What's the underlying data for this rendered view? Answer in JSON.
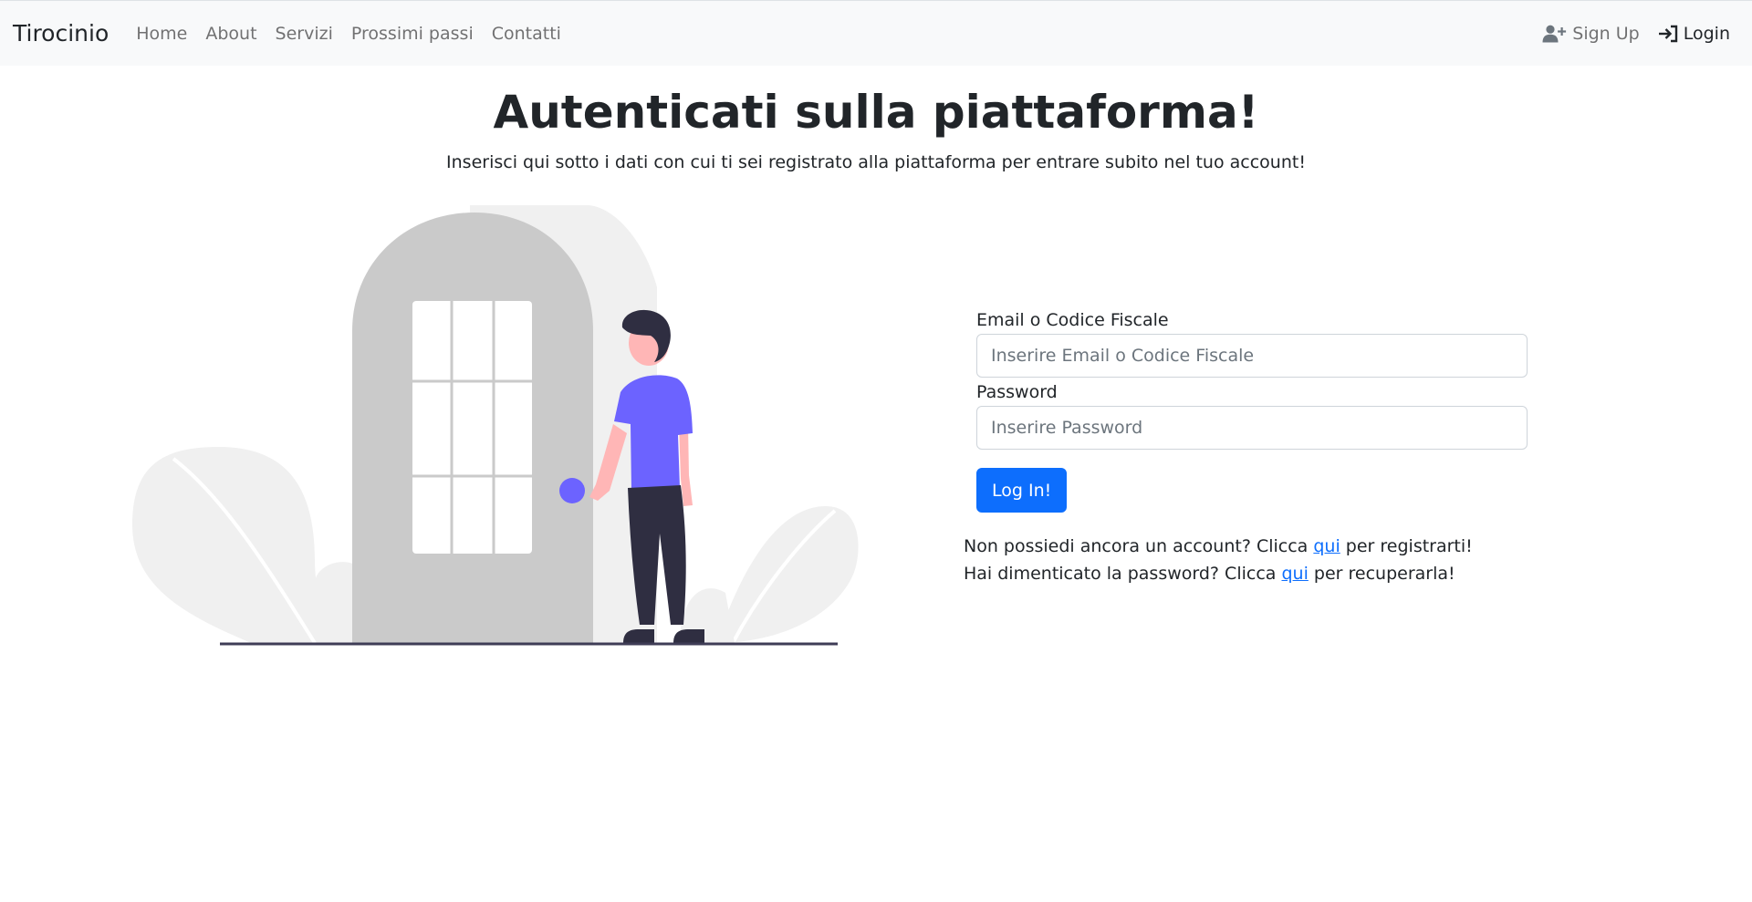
{
  "navbar": {
    "brand": "Tirocinio",
    "links": [
      "Home",
      "About",
      "Servizi",
      "Prossimi passi",
      "Contatti"
    ],
    "signup_label": "Sign Up",
    "login_label": "Login",
    "signup_icon": "user-plus-icon",
    "login_icon": "sign-in-icon"
  },
  "page": {
    "title": "Autenticati sulla piattaforma!",
    "subtitle": "Inserisci qui sotto i dati con cui ti sei registrato alla piattaforma per entrare subito nel tuo account!"
  },
  "form": {
    "email_label": "Email o Codice Fiscale",
    "email_placeholder": "Inserire Email o Codice Fiscale",
    "email_value": "",
    "password_label": "Password",
    "password_placeholder": "Inserire Password",
    "password_value": "",
    "submit_label": "Log In!"
  },
  "help": {
    "register_prefix": "Non possiedi ancora un account? Clicca",
    "register_link": "qui",
    "register_suffix": "per registrarti!",
    "recover_prefix": "Hai dimenticato la password? Clicca",
    "recover_link": "qui",
    "recover_suffix": "per recuperarla!"
  },
  "colors": {
    "primary": "#0d6efd",
    "navbar_bg": "#f8f9fa",
    "illustration_accent": "#6c63ff"
  }
}
